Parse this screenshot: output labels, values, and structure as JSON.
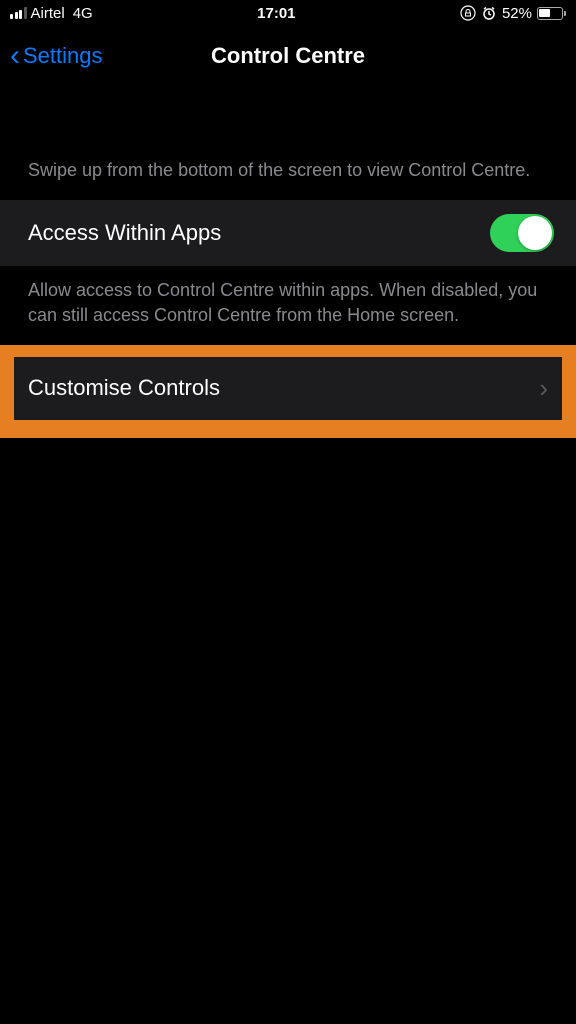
{
  "statusBar": {
    "carrier": "Airtel",
    "network": "4G",
    "time": "17:01",
    "battery": "52%"
  },
  "nav": {
    "back": "Settings",
    "title": "Control Centre"
  },
  "section1": {
    "description": "Swipe up from the bottom of the screen to view Control Centre."
  },
  "accessRow": {
    "label": "Access Within Apps"
  },
  "section2": {
    "description": "Allow access to Control Centre within apps. When disabled, you can still access Control Centre from the Home screen."
  },
  "customiseRow": {
    "label": "Customise Controls"
  }
}
